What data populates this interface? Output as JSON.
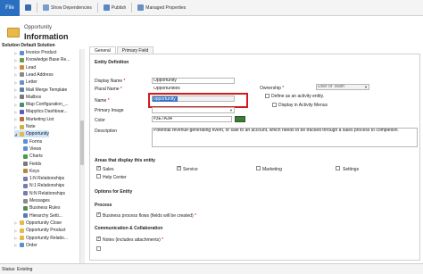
{
  "ribbon": {
    "file_label": "File",
    "show_dependencies": "Show Dependencies",
    "publish": "Publish",
    "managed_properties": "Managed Properties"
  },
  "header": {
    "entity": "Opportunity",
    "title": "Information"
  },
  "solution_label": "Solution Default Solution",
  "tree": [
    {
      "label": "Invoice Product",
      "arrow": "▷",
      "color": "#5a8fd0"
    },
    {
      "label": "Knowledge Base Re...",
      "arrow": "▷",
      "color": "#6b9c4a"
    },
    {
      "label": "Lead",
      "arrow": "▷",
      "color": "#d08a3a"
    },
    {
      "label": "Lead Address",
      "arrow": "▷",
      "color": "#8a8a8a"
    },
    {
      "label": "Letter",
      "arrow": "▷",
      "color": "#6b8fc6"
    },
    {
      "label": "Mail Merge Template",
      "arrow": "▷",
      "color": "#5b7fb0"
    },
    {
      "label": "Mailbox",
      "arrow": "▷",
      "color": "#7a7a7a"
    },
    {
      "label": "Map Configuration_...",
      "arrow": "▷",
      "color": "#4a8a7a"
    },
    {
      "label": "Mapytics Dashboar...",
      "arrow": "▷",
      "color": "#5a5ac0"
    },
    {
      "label": "Marketing List",
      "arrow": "▷",
      "color": "#c06a3a"
    },
    {
      "label": "Note",
      "arrow": "▷",
      "color": "#d0b040"
    },
    {
      "label": "Opportunity",
      "arrow": "◢",
      "color": "#e8b84a",
      "selected": true
    },
    {
      "label": "Forms",
      "child": true,
      "color": "#5a8fd0"
    },
    {
      "label": "Views",
      "child": true,
      "color": "#5a8fd0"
    },
    {
      "label": "Charts",
      "child": true,
      "color": "#4a9a4a"
    },
    {
      "label": "Fields",
      "child": true,
      "color": "#7a7a7a"
    },
    {
      "label": "Keys",
      "child": true,
      "color": "#b08a3a"
    },
    {
      "label": "1:N Relationships",
      "child": true,
      "color": "#7a7ab0"
    },
    {
      "label": "N:1 Relationships",
      "child": true,
      "color": "#7a7ab0"
    },
    {
      "label": "N:N Relationships",
      "child": true,
      "color": "#7a7ab0"
    },
    {
      "label": "Messages",
      "child": true,
      "color": "#8a8a8a"
    },
    {
      "label": "Business Rules",
      "child": true,
      "color": "#5a8a5a"
    },
    {
      "label": "Hierarchy Setti...",
      "child": true,
      "color": "#5a7ab0"
    },
    {
      "label": "Opportunity Close",
      "arrow": "▷",
      "color": "#e8b84a"
    },
    {
      "label": "Opportunity Product",
      "arrow": "▷",
      "color": "#e8b84a"
    },
    {
      "label": "Opportunity Relatio...",
      "arrow": "▷",
      "color": "#e8b84a"
    },
    {
      "label": "Order",
      "arrow": "▷",
      "color": "#5a8fd0"
    }
  ],
  "tabs": [
    "General",
    "Primary Field"
  ],
  "form": {
    "entity_definition": "Entity Definition",
    "display_name_label": "Display Name",
    "display_name_value": "Opportunity",
    "plural_name_label": "Plural Name",
    "plural_name_value": "Opportunities",
    "name_label": "Name",
    "name_value": "opportunity",
    "primary_image_label": "Primary Image",
    "color_label": "Color",
    "color_value": "#3E7A3A",
    "description_label": "Description",
    "description_value": "Potential revenue-generating event, or sale to an account, which needs to be tracked through a sales process to completion.",
    "ownership_label": "Ownership",
    "ownership_value": "User or Team",
    "define_activity": "Define as an activity entity.",
    "display_activity_menus": "Display in Activity Menus",
    "areas_title": "Areas that display this entity",
    "area_sales": "Sales",
    "area_service": "Service",
    "area_marketing": "Marketing",
    "area_settings": "Settings",
    "area_help": "Help Center",
    "options_title": "Options for Entity",
    "process_title": "Process",
    "business_process": "Business process flows (fields will be created)",
    "comm_title": "Communication & Collaboration",
    "notes": "Notes (includes attachments)"
  },
  "status": "Status: Existing"
}
